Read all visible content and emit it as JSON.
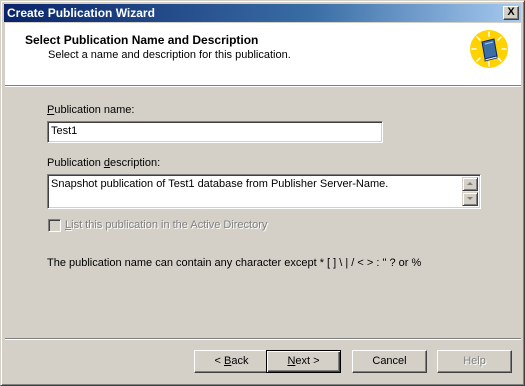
{
  "window": {
    "title": "Create Publication Wizard",
    "close_label": "X"
  },
  "header": {
    "title": "Select Publication Name and Description",
    "subtitle": "Select a name and description for this publication."
  },
  "form": {
    "name_label_mnemonic": "P",
    "name_label_rest": "ublication name:",
    "name_value": "Test1",
    "desc_label_before": "Publication ",
    "desc_label_mnemonic": "d",
    "desc_label_after": "escription:",
    "desc_value": "Snapshot publication of Test1 database from Publisher Server-Name.",
    "ad_checkbox_mnemonic": "L",
    "ad_checkbox_rest": "ist this publication in the Active Directory",
    "ad_checkbox_checked": false,
    "hint": "The publication name can contain any character except * [ ] \\ | / < > : \" ? or %"
  },
  "buttons": {
    "back_prefix": "< ",
    "back_mnemonic": "B",
    "back_rest": "ack",
    "next_mnemonic": "N",
    "next_rest": "ext >",
    "cancel": "Cancel",
    "help": "Help"
  },
  "colors": {
    "title_bar_start": "#0a246a",
    "title_bar_end": "#a6caf0",
    "dialog_face": "#d4d0c8",
    "icon_disc": "#ffd200",
    "icon_book": "#3a6ea5"
  }
}
